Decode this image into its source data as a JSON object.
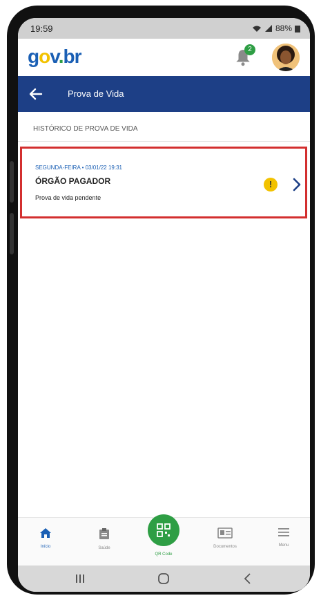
{
  "status_bar": {
    "time": "19:59",
    "battery": "88%"
  },
  "header": {
    "logo_parts": [
      "g",
      "o",
      "v",
      ".",
      "br"
    ],
    "notification_count": "2"
  },
  "nav": {
    "title": "Prova de Vida"
  },
  "section": {
    "title": "HISTÓRICO DE PROVA DE VIDA"
  },
  "records": [
    {
      "date": "SEGUNDA-FEIRA • 03/01/22 19:31",
      "organ": "ÓRGÃO PAGADOR",
      "status": "Prova de vida pendente",
      "alert_symbol": "!"
    }
  ],
  "tabbar": {
    "items": [
      {
        "label": "Início",
        "icon": "home-icon"
      },
      {
        "label": "Saúde",
        "icon": "clipboard-icon"
      },
      {
        "label": "QR Code",
        "icon": "qr-code-icon"
      },
      {
        "label": "Documentos",
        "icon": "id-card-icon"
      },
      {
        "label": "Menu",
        "icon": "menu-icon"
      }
    ]
  },
  "colors": {
    "primary": "#1d3f86",
    "accent_green": "#2e9e44",
    "warning": "#f2c200",
    "highlight": "#d32f2f"
  }
}
